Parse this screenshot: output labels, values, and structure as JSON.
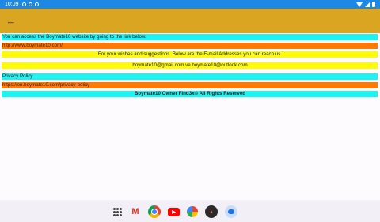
{
  "status_bar": {
    "time": "10:09"
  },
  "app_bar": {
    "back_icon": "arrow-back-icon",
    "back_glyph": "←"
  },
  "content": {
    "intro": "You can access the Boymate10 website by going to the link below.",
    "website_link": "http://www.boymate10.com/",
    "suggestions": "For your wishes and suggestions. Below are the E-mail Addresses you can reach us.",
    "emails": "boymate10@gmail.com ve boymate10@outlook.com",
    "privacy_heading": "Privacy Policy",
    "privacy_link": "https://en.boymate10.com/privacy-policy",
    "footer": "Boymate10 Owner Find3x© All Rights Reserved"
  },
  "colors": {
    "app_bar": "#daa520",
    "status_bar": "#1e88e5",
    "cyan": "#1cf4f2",
    "orange": "#ff7a05",
    "yellow": "#fffb03"
  },
  "dock": {
    "items": [
      "app-drawer-icon",
      "gmail-icon",
      "chrome-icon",
      "youtube-icon",
      "photos-icon",
      "game-app-icon",
      "messages-icon"
    ],
    "gmail_glyph": "M"
  }
}
